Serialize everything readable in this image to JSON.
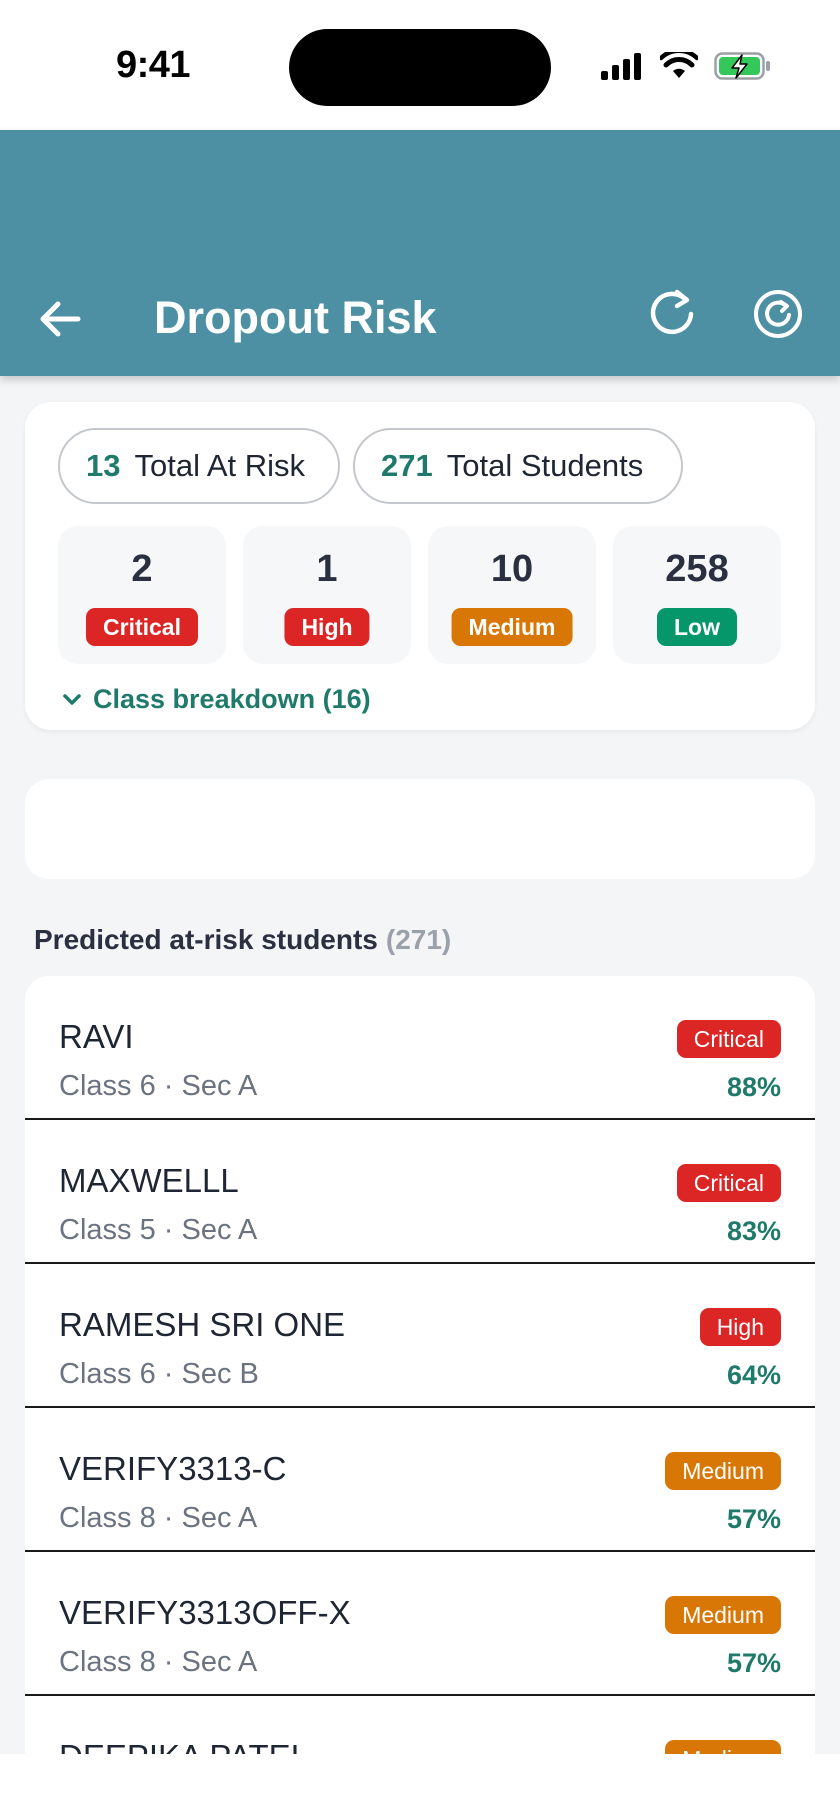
{
  "status_bar": {
    "time": "9:41"
  },
  "header": {
    "title": "Dropout Risk",
    "bg_color": "#4d8fa3"
  },
  "summary": {
    "at_risk": {
      "count": "13",
      "label": "Total At Risk"
    },
    "total": {
      "count": "271",
      "label": "Total Students"
    },
    "tiles": [
      {
        "count": "2",
        "label": "Critical",
        "color": "#dc2626"
      },
      {
        "count": "1",
        "label": "High",
        "color": "#dc2626"
      },
      {
        "count": "10",
        "label": "Medium",
        "color": "#d97706"
      },
      {
        "count": "258",
        "label": "Low",
        "color": "#059669"
      }
    ],
    "breakdown_label": "Class breakdown (16)"
  },
  "students_section": {
    "heading": "Predicted at-risk students",
    "count": "(271)"
  },
  "students": [
    {
      "name": "RAVI",
      "class": "Class 6 · Sec A",
      "risk": "Critical",
      "risk_color": "#dc2626",
      "pct": "88%"
    },
    {
      "name": "MAXWELLL",
      "class": "Class 5 · Sec A",
      "risk": "Critical",
      "risk_color": "#dc2626",
      "pct": "83%"
    },
    {
      "name": "RAMESH SRI ONE",
      "class": "Class 6 · Sec B",
      "risk": "High",
      "risk_color": "#dc2626",
      "pct": "64%"
    },
    {
      "name": "VERIFY3313-C",
      "class": "Class 8 · Sec A",
      "risk": "Medium",
      "risk_color": "#d97706",
      "pct": "57%"
    },
    {
      "name": "VERIFY3313OFF-X",
      "class": "Class 8 · Sec A",
      "risk": "Medium",
      "risk_color": "#d97706",
      "pct": "57%"
    },
    {
      "name": "DEEPIKA PATEL",
      "class": "",
      "risk": "Medium",
      "risk_color": "#d97706",
      "pct": ""
    }
  ],
  "accent_color": "#1f7a6b"
}
